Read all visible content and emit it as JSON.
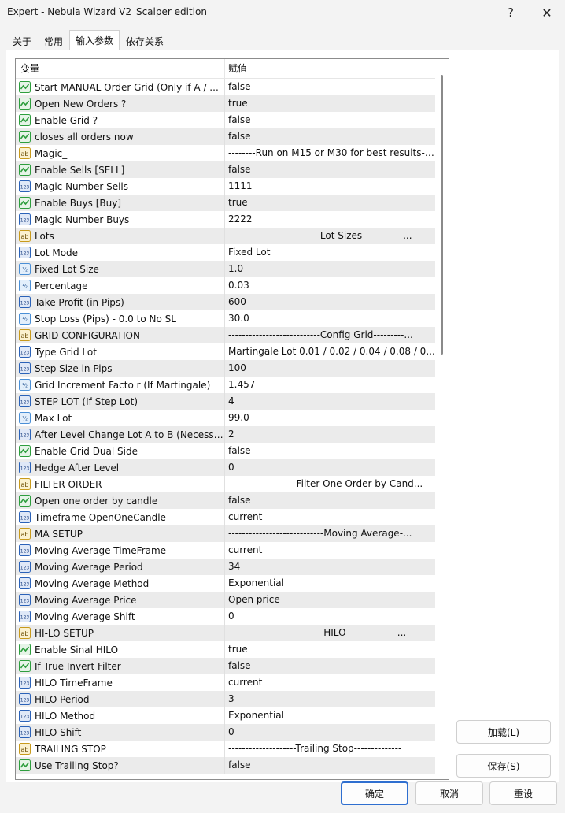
{
  "window": {
    "title": "Expert - Nebula Wizard V2_Scalper edition",
    "help_glyph": "?",
    "close_glyph": "✕"
  },
  "tabs": [
    "关于",
    "常用",
    "输入参数",
    "依存关系"
  ],
  "active_tab": 2,
  "grid": {
    "header": {
      "variable": "变量",
      "value": "赋值"
    },
    "rows": [
      {
        "icon": "bool-icon",
        "name": "Start MANUAL Order  Grid  (Only if A / ...",
        "value": "false"
      },
      {
        "icon": "bool-icon",
        "name": "Open New Orders ?",
        "value": "true"
      },
      {
        "icon": "bool-icon",
        "name": "Enable Grid ?",
        "value": "false"
      },
      {
        "icon": "bool-icon",
        "name": "closes all orders now",
        "value": "false"
      },
      {
        "icon": "string-icon",
        "name": "Magic_",
        "value": "--------Run on M15 or M30 for best results-----"
      },
      {
        "icon": "bool-icon",
        "name": "Enable Sells   [SELL]",
        "value": "false"
      },
      {
        "icon": "int-icon",
        "name": "Magic Number Sells",
        "value": "1111"
      },
      {
        "icon": "bool-icon",
        "name": "Enable Buys   [Buy]",
        "value": "true"
      },
      {
        "icon": "int-icon",
        "name": "Magic Number Buys",
        "value": "2222"
      },
      {
        "icon": "string-icon",
        "name": "Lots",
        "value": "---------------------------Lot Sizes------------..."
      },
      {
        "icon": "int-icon",
        "name": "Lot Mode",
        "value": "Fixed Lot"
      },
      {
        "icon": "double-icon",
        "name": "Fixed Lot Size",
        "value": "1.0"
      },
      {
        "icon": "double-icon",
        "name": "Percentage",
        "value": "0.03"
      },
      {
        "icon": "int-icon",
        "name": "Take Profit (in Pips)",
        "value": "600"
      },
      {
        "icon": "double-icon",
        "name": "Stop Loss (Pips) - 0.0 to No SL",
        "value": "30.0"
      },
      {
        "icon": "string-icon",
        "name": "GRID CONFIGURATION",
        "value": "---------------------------Config Grid---------..."
      },
      {
        "icon": "int-icon",
        "name": "Type Grid Lot",
        "value": "Martingale Lot  0.01 / 0.02 / 0.04 / 0.08 / 0..."
      },
      {
        "icon": "int-icon",
        "name": "Step Size in Pips",
        "value": "100"
      },
      {
        "icon": "double-icon",
        "name": "Grid Increment Facto r (If Martingale)",
        "value": "1.457"
      },
      {
        "icon": "int-icon",
        "name": "STEP LOT (If  Step Lot)",
        "value": "4"
      },
      {
        "icon": "double-icon",
        "name": "Max Lot",
        "value": "99.0"
      },
      {
        "icon": "int-icon",
        "name": "After Level Change Lot A to B (Necessa...",
        "value": "2"
      },
      {
        "icon": "bool-icon",
        "name": "Enable Grid Dual Side",
        "value": "false"
      },
      {
        "icon": "int-icon",
        "name": "Hedge After Level",
        "value": "0"
      },
      {
        "icon": "string-icon",
        "name": "FILTER ORDER",
        "value": "--------------------Filter One Order by Cand..."
      },
      {
        "icon": "bool-icon",
        "name": "Open one order by candle",
        "value": "false"
      },
      {
        "icon": "int-icon",
        "name": "Timeframe OpenOneCandle",
        "value": "current"
      },
      {
        "icon": "string-icon",
        "name": "MA SETUP",
        "value": "----------------------------Moving Average-..."
      },
      {
        "icon": "int-icon",
        "name": "Moving Average TimeFrame",
        "value": "current"
      },
      {
        "icon": "int-icon",
        "name": "Moving Average Period",
        "value": "34"
      },
      {
        "icon": "int-icon",
        "name": "Moving Average Method",
        "value": "Exponential"
      },
      {
        "icon": "int-icon",
        "name": "Moving Average Price",
        "value": "Open price"
      },
      {
        "icon": "int-icon",
        "name": "Moving Average Shift",
        "value": "0"
      },
      {
        "icon": "string-icon",
        "name": "HI-LO SETUP",
        "value": "----------------------------HILO---------------..."
      },
      {
        "icon": "bool-icon",
        "name": "Enable Sinal  HILO",
        "value": "true"
      },
      {
        "icon": "bool-icon",
        "name": "If True Invert Filter",
        "value": "false"
      },
      {
        "icon": "int-icon",
        "name": "HILO TimeFrame",
        "value": "current"
      },
      {
        "icon": "int-icon",
        "name": "HILO Period",
        "value": "3"
      },
      {
        "icon": "int-icon",
        "name": "HILO Method",
        "value": "Exponential"
      },
      {
        "icon": "int-icon",
        "name": "HILO Shift",
        "value": "0"
      },
      {
        "icon": "string-icon",
        "name": "TRAILING STOP",
        "value": "--------------------Trailing Stop--------------"
      },
      {
        "icon": "bool-icon",
        "name": "Use Trailing Stop?",
        "value": "false"
      }
    ]
  },
  "side_buttons": {
    "load": "加载(L)",
    "save": "保存(S)"
  },
  "footer_buttons": {
    "ok": "确定",
    "cancel": "取消",
    "reset": "重设"
  },
  "colors": {
    "bool_icon": "#2e9e3e",
    "int_icon": "#2b62b8",
    "double_icon": "#4a8fd6",
    "string_icon": "#c89a1c",
    "primary_border": "#2f6fd0"
  }
}
